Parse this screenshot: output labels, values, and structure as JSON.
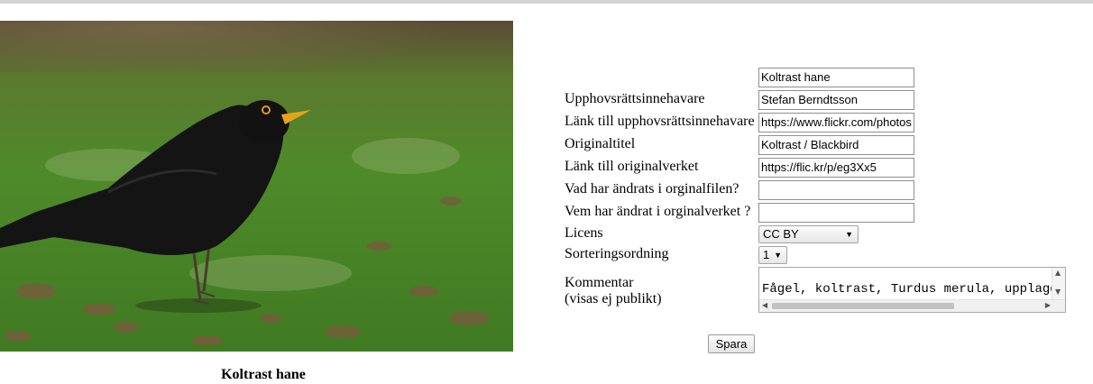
{
  "image": {
    "caption": "Koltrast hane"
  },
  "form": {
    "title_value": "Koltrast hane",
    "copyright_holder_label": "Upphovsrättsinnehavare",
    "copyright_holder_value": "Stefan Berndtsson",
    "copyright_link_label": "Länk till upphovsrättsinnehavare",
    "copyright_link_value": "https://www.flickr.com/photos",
    "original_title_label": "Originaltitel",
    "original_title_value": "Koltrast / Blackbird",
    "original_link_label": "Länk till originalverket",
    "original_link_value": "https://flic.kr/p/eg3Xx5",
    "changed_what_label": "Vad har ändrats i orginalfilen?",
    "changed_what_value": "",
    "changed_who_label": "Vem har ändrat i orginalverket ?",
    "changed_who_value": "",
    "license_label": "Licens",
    "license_value": "CC BY",
    "sort_label": "Sorteringsordning",
    "sort_value": "1",
    "comment_label": "Kommentar",
    "comment_sublabel": "(visas ej publikt)",
    "comment_value": "Fågel, koltrast, Turdus merula, upplagd",
    "save_label": "Spara"
  }
}
